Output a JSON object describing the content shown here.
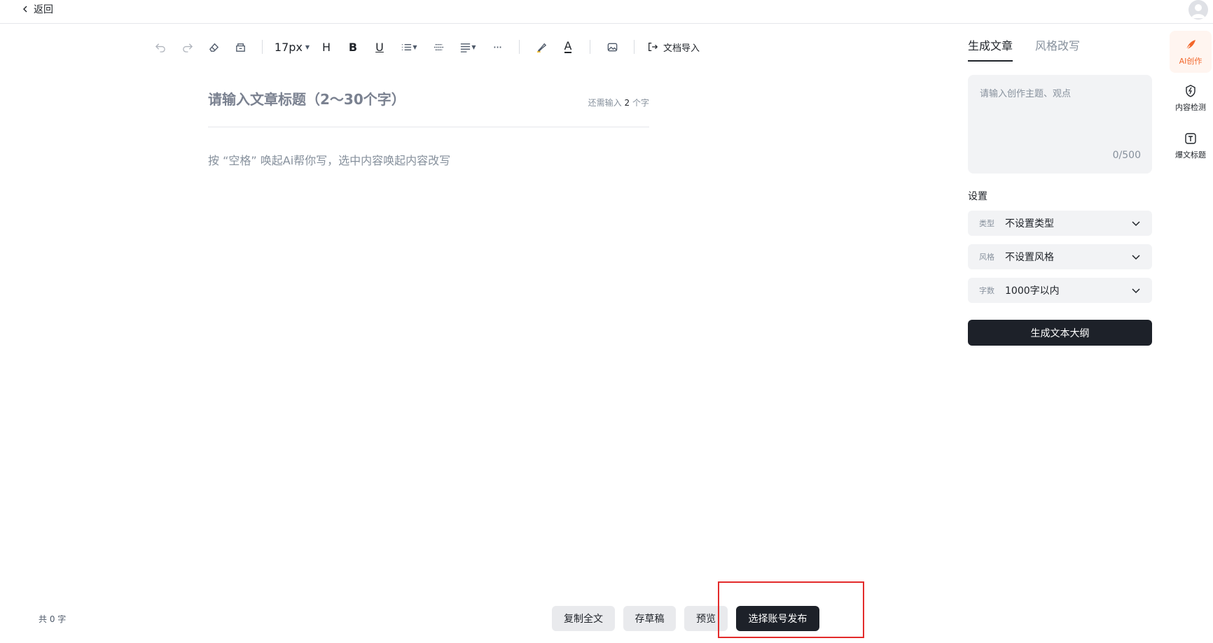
{
  "topbar": {
    "back_label": "返回"
  },
  "toolbar": {
    "font_size": "17px",
    "heading_glyph": "H",
    "bold_glyph": "B",
    "underline_glyph": "U",
    "more_glyph": "···",
    "color_glyph": "A",
    "import_label": "文档导入"
  },
  "editor": {
    "title_placeholder": "请输入文章标题（2～30个字）",
    "title_count_prefix": "还需输入",
    "title_count_value": "2",
    "title_count_suffix": "个字",
    "body_placeholder": "按 “空格” 唤起Ai帮你写，选中内容唤起内容改写"
  },
  "panel": {
    "tabs": [
      {
        "label": "生成文章",
        "active": true
      },
      {
        "label": "风格改写",
        "active": false
      }
    ],
    "topic_placeholder": "请输入创作主题、观点",
    "topic_count": "0/500",
    "settings_label": "设置",
    "selects": [
      {
        "key": "类型",
        "value": "不设置类型"
      },
      {
        "key": "风格",
        "value": "不设置风格"
      },
      {
        "key": "字数",
        "value": "1000字以内"
      }
    ],
    "generate_label": "生成文本大纲"
  },
  "rail": {
    "items": [
      {
        "label": "AI创作",
        "icon": "feather-icon",
        "active": true
      },
      {
        "label": "内容检测",
        "icon": "shield-bolt-icon",
        "active": false
      },
      {
        "label": "爆文标题",
        "icon": "text-t-icon",
        "active": false
      }
    ]
  },
  "footer": {
    "word_count": "共 0 字",
    "copy_label": "复制全文",
    "draft_label": "存草稿",
    "preview_label": "预览",
    "publish_label": "选择账号发布"
  },
  "colors": {
    "accent_dark": "#1d2129",
    "ai_orange": "#f2662a",
    "highlight_red": "#e32b2b"
  }
}
